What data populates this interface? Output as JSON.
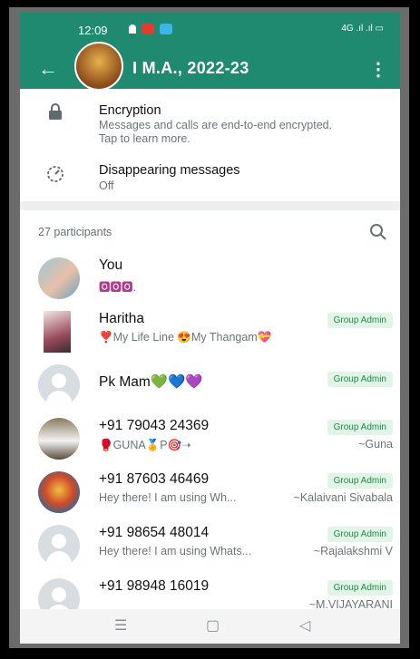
{
  "status_bar": {
    "time": "12:09",
    "right_icons": "4G  .ıl  .ıl  ▭"
  },
  "header": {
    "title": "I M.A., 2022-23",
    "back_icon": "arrow-left-icon",
    "menu_icon": "more-vert-icon",
    "color": "#1f8a70"
  },
  "info": {
    "encryption": {
      "title": "Encryption",
      "description": "Messages and calls are end-to-end encrypted. Tap to learn more.",
      "icon": "lock-icon"
    },
    "disappearing": {
      "title": "Disappearing messages",
      "value": "Off",
      "icon": "timer-icon"
    }
  },
  "participants": {
    "count_label": "27 participants",
    "list": [
      {
        "name": "You",
        "status": "🅾🅾🅾.",
        "badge": "",
        "alias": "",
        "avatar": "photo-kids"
      },
      {
        "name": "Haritha",
        "status": "❣️My Life Line 😍My Thangam💝",
        "badge": "Group Admin",
        "alias": "",
        "avatar": "photo-doll"
      },
      {
        "name": "Pk Mam💚💙💜",
        "status": "",
        "badge": "Group Admin",
        "alias": "",
        "avatar": "default"
      },
      {
        "name": "+91 79043 24369",
        "status": "🥊GUNA🏅P🎯➝",
        "badge": "Group Admin",
        "alias": "~Guna",
        "avatar": "photo-man"
      },
      {
        "name": "+91 87603 46469",
        "status": "Hey there! I am using Wh...",
        "badge": "Group Admin",
        "alias": "~Kalaivani Sivabala",
        "avatar": "photo-deity"
      },
      {
        "name": "+91 98654 48014",
        "status": "Hey there! I am using Whats...",
        "badge": "Group Admin",
        "alias": "~Rajalakshmi V",
        "avatar": "default"
      },
      {
        "name": "+91 98948 16019",
        "status": "",
        "badge": "Group Admin",
        "alias": "~M.VIJAYARANI",
        "avatar": "default"
      }
    ]
  },
  "nav": {
    "menu": "☰",
    "home": "▢",
    "back": "◁"
  }
}
